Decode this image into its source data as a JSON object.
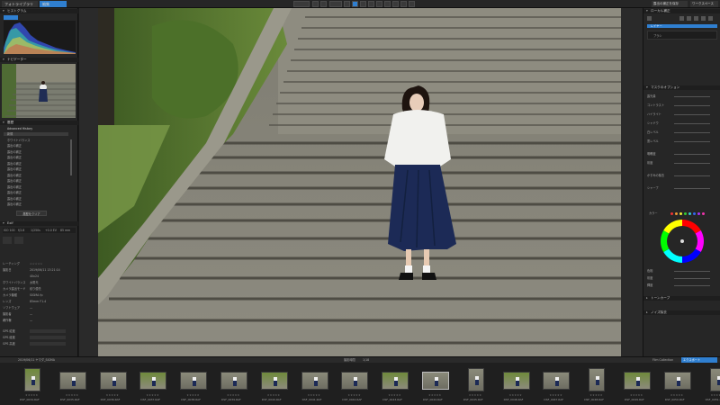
{
  "topbar": {
    "tab_library": "フォトライブラリ",
    "tab_customize": "編集",
    "right_btn_1": "露出の補正を保存",
    "right_btn_2": "ワークスペース"
  },
  "left_panel": {
    "histogram_title": "ヒストグラム",
    "navigator_title": "ナビゲーター",
    "history_title": "履歴",
    "history_section": "Advanced History",
    "history_items": [
      "新規",
      "ホワイトバランス",
      "露出の補正",
      "露出の補正",
      "露出の補正",
      "露出の補正",
      "露出の補正",
      "露出の補正",
      "露出の補正",
      "露出の補正",
      "露出の補正",
      "露出の補正",
      "露出の補正"
    ],
    "history_btn": "履歴をクリア",
    "exif_title": "Exif",
    "exif_values": [
      "ISO 100",
      "f/2.8",
      "1/250s",
      "+0.0 EV",
      "85 mm"
    ],
    "exif_rows": [
      {
        "label": "レーティング",
        "value": "☆☆☆☆☆"
      },
      {
        "label": "撮影日",
        "value": "2019/06/11 13:21:14"
      },
      {
        "label": "",
        "value": "40x24"
      },
      {
        "label": "ホワイトバランス",
        "value": "太陽光"
      },
      {
        "label": "カメラ露出モード",
        "value": "絞り優先"
      },
      {
        "label": "カメラ機種",
        "value": "SIGMA fp"
      },
      {
        "label": "レンズ",
        "value": "85mm F1.4"
      },
      {
        "label": "ソフトウェア",
        "value": "—"
      },
      {
        "label": "撮影者",
        "value": "—"
      },
      {
        "label": "著作権",
        "value": "—"
      },
      {
        "label": "GPS 緯度",
        "value": ""
      },
      {
        "label": "GPS 経度",
        "value": ""
      },
      {
        "label": "GPS 高度",
        "value": ""
      }
    ]
  },
  "right_panel": {
    "tools_title": "ローカル補正",
    "layer_label": "レイヤー",
    "brush_label": "ブラシ",
    "mask_title": "マスクのオプション",
    "sliders": [
      "露光量",
      "コントラスト",
      "ハイライト",
      "シャドウ",
      "白レベル",
      "黒レベル",
      "明瞭度",
      "彩度",
      "かすみの除去",
      "シャープ"
    ],
    "color_label": "カラー",
    "hsl_labels": [
      "色相",
      "彩度",
      "輝度"
    ],
    "extra_labels": [
      "トーンカーブ",
      "ノイズ除去"
    ]
  },
  "filmstrip": {
    "path": "2019/06/11 ヤマダ_SIGMA",
    "center_label": "撮影時間",
    "center_count": "1/18",
    "btn_collection": "Film Collection",
    "btn_export": "エクスポート",
    "thumbs": [
      "DSF_0034.RAF",
      "DSF_0035.RAF",
      "DSF_0036.RAF",
      "DSF_0037.RAF",
      "DSF_0038.RAF",
      "DSF_0039.RAF",
      "DSF_0040.RAF",
      "DSF_0041.RAF",
      "DSF_0042.RAF",
      "DSF_0043.RAF",
      "DSF_0044.RAF",
      "DSF_0045.RAF",
      "DSF_0046.RAF",
      "DSF_0047.RAF",
      "DSF_0048.RAF",
      "DSF_0049.RAF",
      "DSF_0050.RAF",
      "DSF_0051.RAF"
    ]
  },
  "colors": {
    "accent": "#2f7fd0",
    "panel": "#262626",
    "header": "#1e1e1e"
  }
}
